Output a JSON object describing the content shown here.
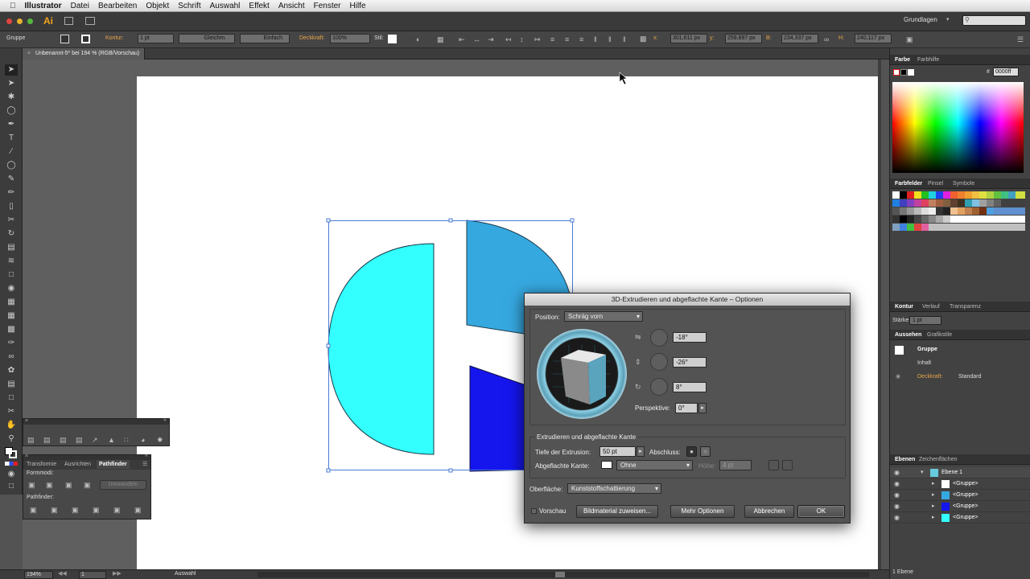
{
  "menubar": {
    "app": "Illustrator",
    "items": [
      "Datei",
      "Bearbeiten",
      "Objekt",
      "Schrift",
      "Auswahl",
      "Effekt",
      "Ansicht",
      "Fenster",
      "Hilfe"
    ]
  },
  "appbar": {
    "logo": "Ai",
    "workspace": "Grundlagen"
  },
  "control": {
    "selection": "Gruppe",
    "kontur_label": "Kontur:",
    "kontur_value": "1 pt",
    "stroke_profile": "Gleichm.",
    "brush": "Einfach",
    "deckkraft_label": "Deckkraft:",
    "deckkraft_value": "100%",
    "stil_label": "Stil:",
    "x_label": "x:",
    "x_value": "301,611 px",
    "y_label": "y:",
    "y_value": "259,897 px",
    "b_label": "B:",
    "b_value": "234,337 px",
    "h_label": "H:",
    "h_value": "240,117 px"
  },
  "document": {
    "tab": "Unbenannt-5* bei 194 % (RGB/Vorschau)"
  },
  "status": {
    "zoom": "194%",
    "page": "1",
    "mode": "Auswahl"
  },
  "graph_panel": {},
  "pathfinder": {
    "tabs": [
      "Transformie",
      "Ausrichten",
      "Pathfinder"
    ],
    "formmodi": "Formmodi:",
    "umwandeln": "Umwandeln",
    "pathfinder_label": "Pathfinder:"
  },
  "farbe": {
    "tabs": [
      "Farbe",
      "Farbhilfe"
    ],
    "hex": "0000ff"
  },
  "farbfelder": {
    "tabs": [
      "Farbfelder",
      "Pinsel",
      "Symbole"
    ]
  },
  "kontur_panel": {
    "tabs": [
      "Kontur",
      "Verlauf",
      "Transparenz"
    ],
    "staerke_label": "Stärke:",
    "staerke_value": "1 pt"
  },
  "aussehen": {
    "tabs": [
      "Aussehen",
      "Grafikstile"
    ],
    "gruppe": "Gruppe",
    "inhalt": "Inhalt",
    "deckkraft": "Deckkraft:",
    "standard": "Standard"
  },
  "ebenen": {
    "tabs": [
      "Ebenen",
      "Zeichenflächen"
    ],
    "rows": [
      "Ebene 1",
      "<Gruppe>",
      "<Gruppe>",
      "<Gruppe>",
      "<Gruppe>"
    ],
    "footer": "1 Ebene"
  },
  "dialog": {
    "title": "3D-Extrudieren und abgeflachte Kante – Optionen",
    "position_label": "Position:",
    "position_value": "Schräg vorn",
    "rot_x": "-18°",
    "rot_y": "-26°",
    "rot_z": "8°",
    "perspektive_label": "Perspektive:",
    "perspektive_value": "0°",
    "section": "Extrudieren und abgeflachte Kante",
    "tiefe_label": "Tiefe der Extrusion:",
    "tiefe_value": "50 pt",
    "abschluss_label": "Abschluss:",
    "kante_label": "Abgeflachte Kante:",
    "kante_value": "Ohne",
    "hoehe_label": "Höhe:",
    "hoehe_value": "4 pt",
    "oberflaeche_label": "Oberfläche:",
    "oberflaeche_value": "Kunststoffschattierung",
    "vorschau": "Vorschau",
    "btn_bildmaterial": "Bildmaterial zuweisen...",
    "btn_mehr": "Mehr Optionen",
    "btn_abbrechen": "Abbrechen",
    "btn_ok": "OK"
  },
  "colors": {
    "cyan": "#33ffff",
    "mid_blue": "#36a8e0",
    "blue": "#1515ee"
  }
}
